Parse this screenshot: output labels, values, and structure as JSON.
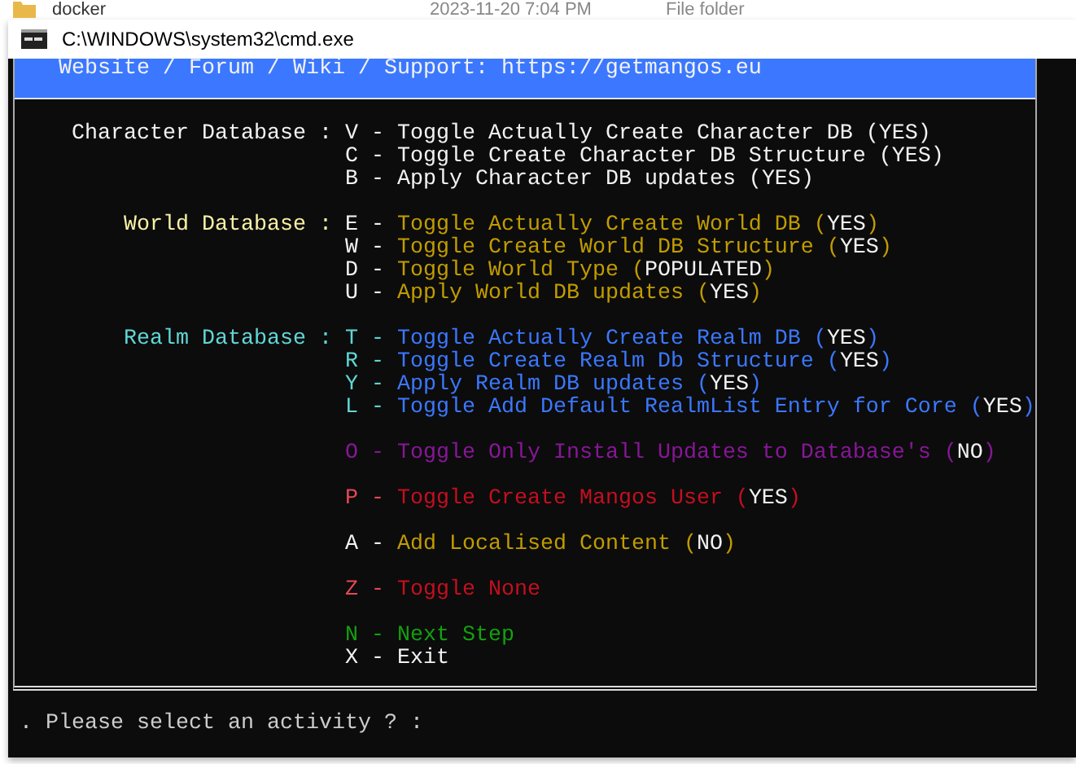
{
  "background_row": {
    "name": "docker",
    "date": "2023-11-20 7:04 PM",
    "type": "File folder"
  },
  "window": {
    "title": "C:\\WINDOWS\\system32\\cmd.exe"
  },
  "header": {
    "text": "Website / Forum / Wiki / Support: https://getmangos.eu"
  },
  "groups": [
    {
      "label": "Character Database :",
      "kind": "character",
      "items": [
        {
          "kind": "character",
          "key": "V -",
          "text": "Toggle Actually Create Character DB (",
          "value": "YES",
          "end": ")"
        },
        {
          "kind": "character",
          "key": "C -",
          "text": "Toggle Create Character DB Structure (",
          "value": "YES",
          "end": ")"
        },
        {
          "kind": "character",
          "key": "B -",
          "text": "Apply Character DB updates (",
          "value": "YES",
          "end": ")"
        }
      ]
    },
    {
      "label": "World Database :",
      "kind": "world",
      "items": [
        {
          "kind": "world",
          "key": "E -",
          "text": "Toggle Actually Create World DB (",
          "value": "YES",
          "end": ")"
        },
        {
          "kind": "world",
          "key": "W -",
          "text": "Toggle Create World DB Structure (",
          "value": "YES",
          "end": ")"
        },
        {
          "kind": "world",
          "key": "D -",
          "text": "Toggle World Type (",
          "value": "POPULATED",
          "end": ")"
        },
        {
          "kind": "world",
          "key": "U -",
          "text": "Apply World DB updates (",
          "value": "YES",
          "end": ")"
        }
      ]
    },
    {
      "label": "Realm Database :",
      "kind": "realm",
      "items": [
        {
          "kind": "realm",
          "key": "T -",
          "text": "Toggle Actually Create Realm DB (",
          "value": "YES",
          "end": ")"
        },
        {
          "kind": "realm",
          "key": "R -",
          "text": "Toggle Create Realm Db Structure (",
          "value": "YES",
          "end": ")"
        },
        {
          "kind": "realm",
          "key": "Y -",
          "text": "Apply Realm DB updates (",
          "value": "YES",
          "end": ")"
        },
        {
          "kind": "realm",
          "key": "L -",
          "text": "Toggle Add Default RealmList Entry for Core (",
          "value": "YES",
          "end": ")"
        }
      ]
    },
    {
      "items": [
        {
          "kind": "updates",
          "key": "O -",
          "text": "Toggle Only Install Updates to Database's (",
          "value": "NO",
          "end": ")"
        }
      ]
    },
    {
      "items": [
        {
          "kind": "user",
          "key": "P -",
          "text": "Toggle Create Mangos User (",
          "value": "YES",
          "end": ")"
        }
      ]
    },
    {
      "items": [
        {
          "kind": "content",
          "key": "A -",
          "text": "Add Localised Content (",
          "value": "NO",
          "end": ")"
        }
      ]
    },
    {
      "items": [
        {
          "kind": "none",
          "key": "Z -",
          "text": "Toggle None"
        }
      ]
    },
    {
      "items": [
        {
          "kind": "next",
          "key": "N -",
          "text": "Next Step"
        },
        {
          "kind": "exit",
          "key": "X -",
          "text": "Exit"
        }
      ]
    }
  ],
  "prompt": ". Please select an activity ? :"
}
